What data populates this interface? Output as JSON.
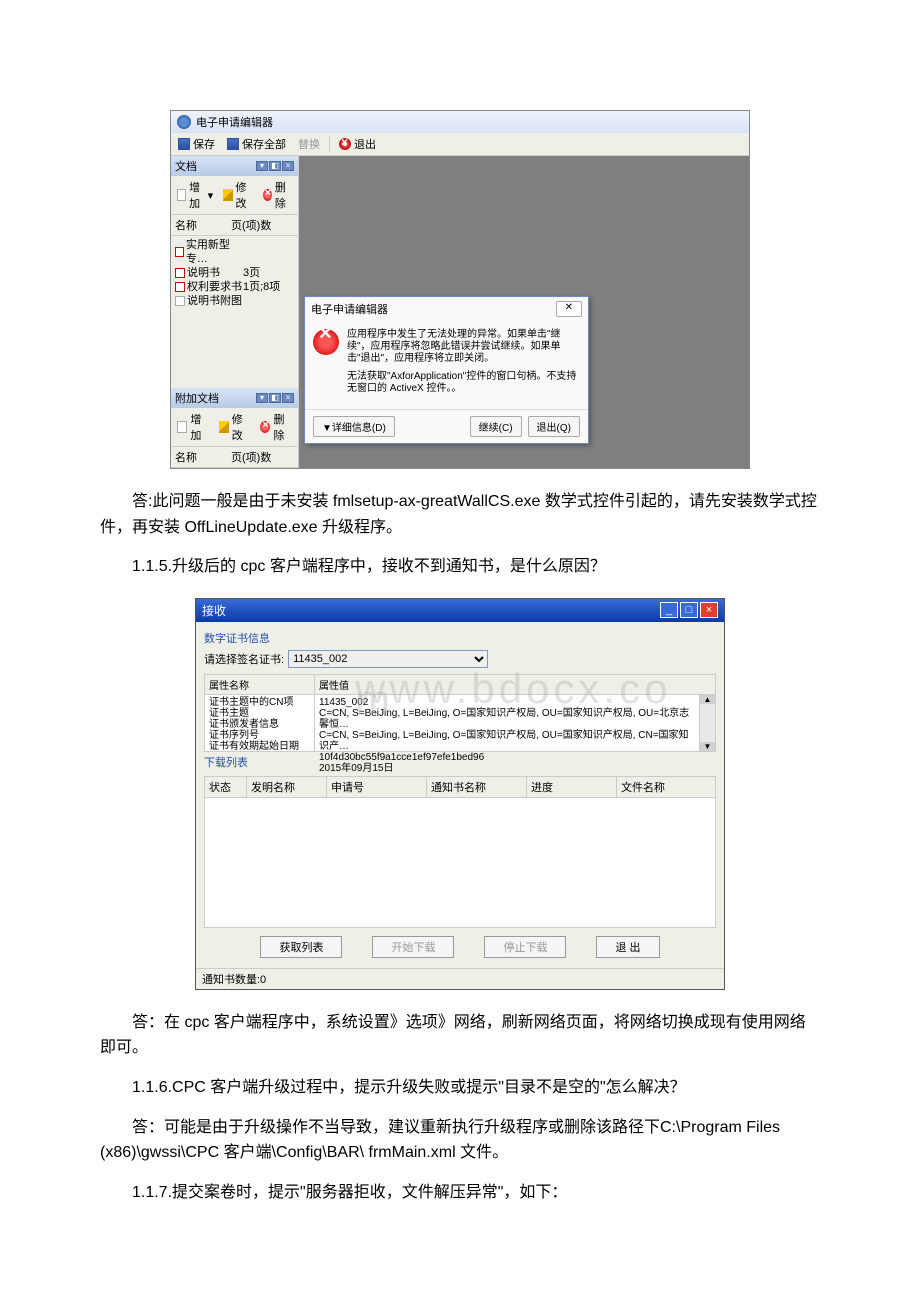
{
  "shot1": {
    "title": "电子申请编辑器",
    "toolbar": {
      "save": "保存",
      "saveAll": "保存全部",
      "replace": "替换",
      "exit": "退出"
    },
    "panel1": {
      "title": "文档",
      "tbAdd": "增加",
      "tbEdit": "修改",
      "tbDel": "删除",
      "colName": "名称",
      "colPages": "页(项)数",
      "rows": [
        {
          "name": "实用新型专…",
          "pages": ""
        },
        {
          "name": "说明书",
          "pages": "3页"
        },
        {
          "name": "权利要求书",
          "pages": "1页;8项"
        },
        {
          "name": "说明书附图",
          "pages": ""
        }
      ]
    },
    "panel2": {
      "title": "附加文档",
      "tbAdd": "增加",
      "tbEdit": "修改",
      "tbDel": "删除",
      "colName": "名称",
      "colPages": "页(项)数"
    },
    "errdlg": {
      "title": "电子申请编辑器",
      "close": "✕",
      "msg1": "应用程序中发生了无法处理的异常。如果单击\"继续\"，应用程序将忽略此错误并尝试继续。如果单击\"退出\"，应用程序将立即关闭。",
      "msg2": "无法获取\"AxforApplication\"控件的窗口句柄。不支持无窗口的 ActiveX 控件。。",
      "btnDetail": "▼详细信息(D)",
      "btnContinue": "继续(C)",
      "btnQuit": "退出(Q)"
    }
  },
  "text": {
    "p1": "答:此问题一般是由于未安装 fmlsetup-ax-greatWallCS.exe 数学式控件引起的，请先安装数学式控件，再安装 OffLineUpdate.exe 升级程序。",
    "p2": "1.1.5.升级后的 cpc 客户端程序中，接收不到通知书，是什么原因？",
    "p3": "答：在 cpc 客户端程序中，系统设置》选项》网络，刷新网络页面，将网络切换成现有使用网络即可。",
    "p4": "1.1.6.CPC 客户端升级过程中，提示升级失败或提示\"目录不是空的\"怎么解决？",
    "p5": "答：可能是由于升级操作不当导致，建议重新执行升级程序或删除该路径下C:\\Program Files (x86)\\gwssi\\CPC 客户端\\Config\\BAR\\ frmMain.xml 文件。",
    "p6": "1.1.7.提交案卷时，提示\"服务器拒收，文件解压异常\"，如下："
  },
  "shot2": {
    "title": "接收",
    "sec1": "数字证书信息",
    "certLabel": "请选择签名证书:",
    "certValue": "11435_002",
    "propHead1": "属性名称",
    "propHead2": "属性值",
    "watermark": "www.bdocx.com",
    "props": [
      {
        "k": "证书主题中的CN项",
        "v": "11435_002"
      },
      {
        "k": "证书主题",
        "v": "C=CN, S=BeiJing, L=BeiJing, O=国家知识产权局, OU=国家知识产权局, OU=北京志馨恒…"
      },
      {
        "k": "证书颁发者信息",
        "v": "C=CN, S=BeiJing, L=BeiJing, O=国家知识产权局, OU=国家知识产权局, CN=国家知识产…"
      },
      {
        "k": "证书序列号",
        "v": "10f4d30bc55f9a1cce1ef97efe1bed96"
      },
      {
        "k": "证书有效期起始日期",
        "v": "2015年09月15日"
      }
    ],
    "sec2": "下载列表",
    "cols": {
      "status": "状态",
      "inv": "发明名称",
      "app": "申请号",
      "notice": "通知书名称",
      "prog": "进度",
      "file": "文件名称"
    },
    "btns": {
      "get": "获取列表",
      "start": "开始下载",
      "stop": "停止下载",
      "exit": "退 出"
    },
    "status": "通知书数量:0"
  }
}
